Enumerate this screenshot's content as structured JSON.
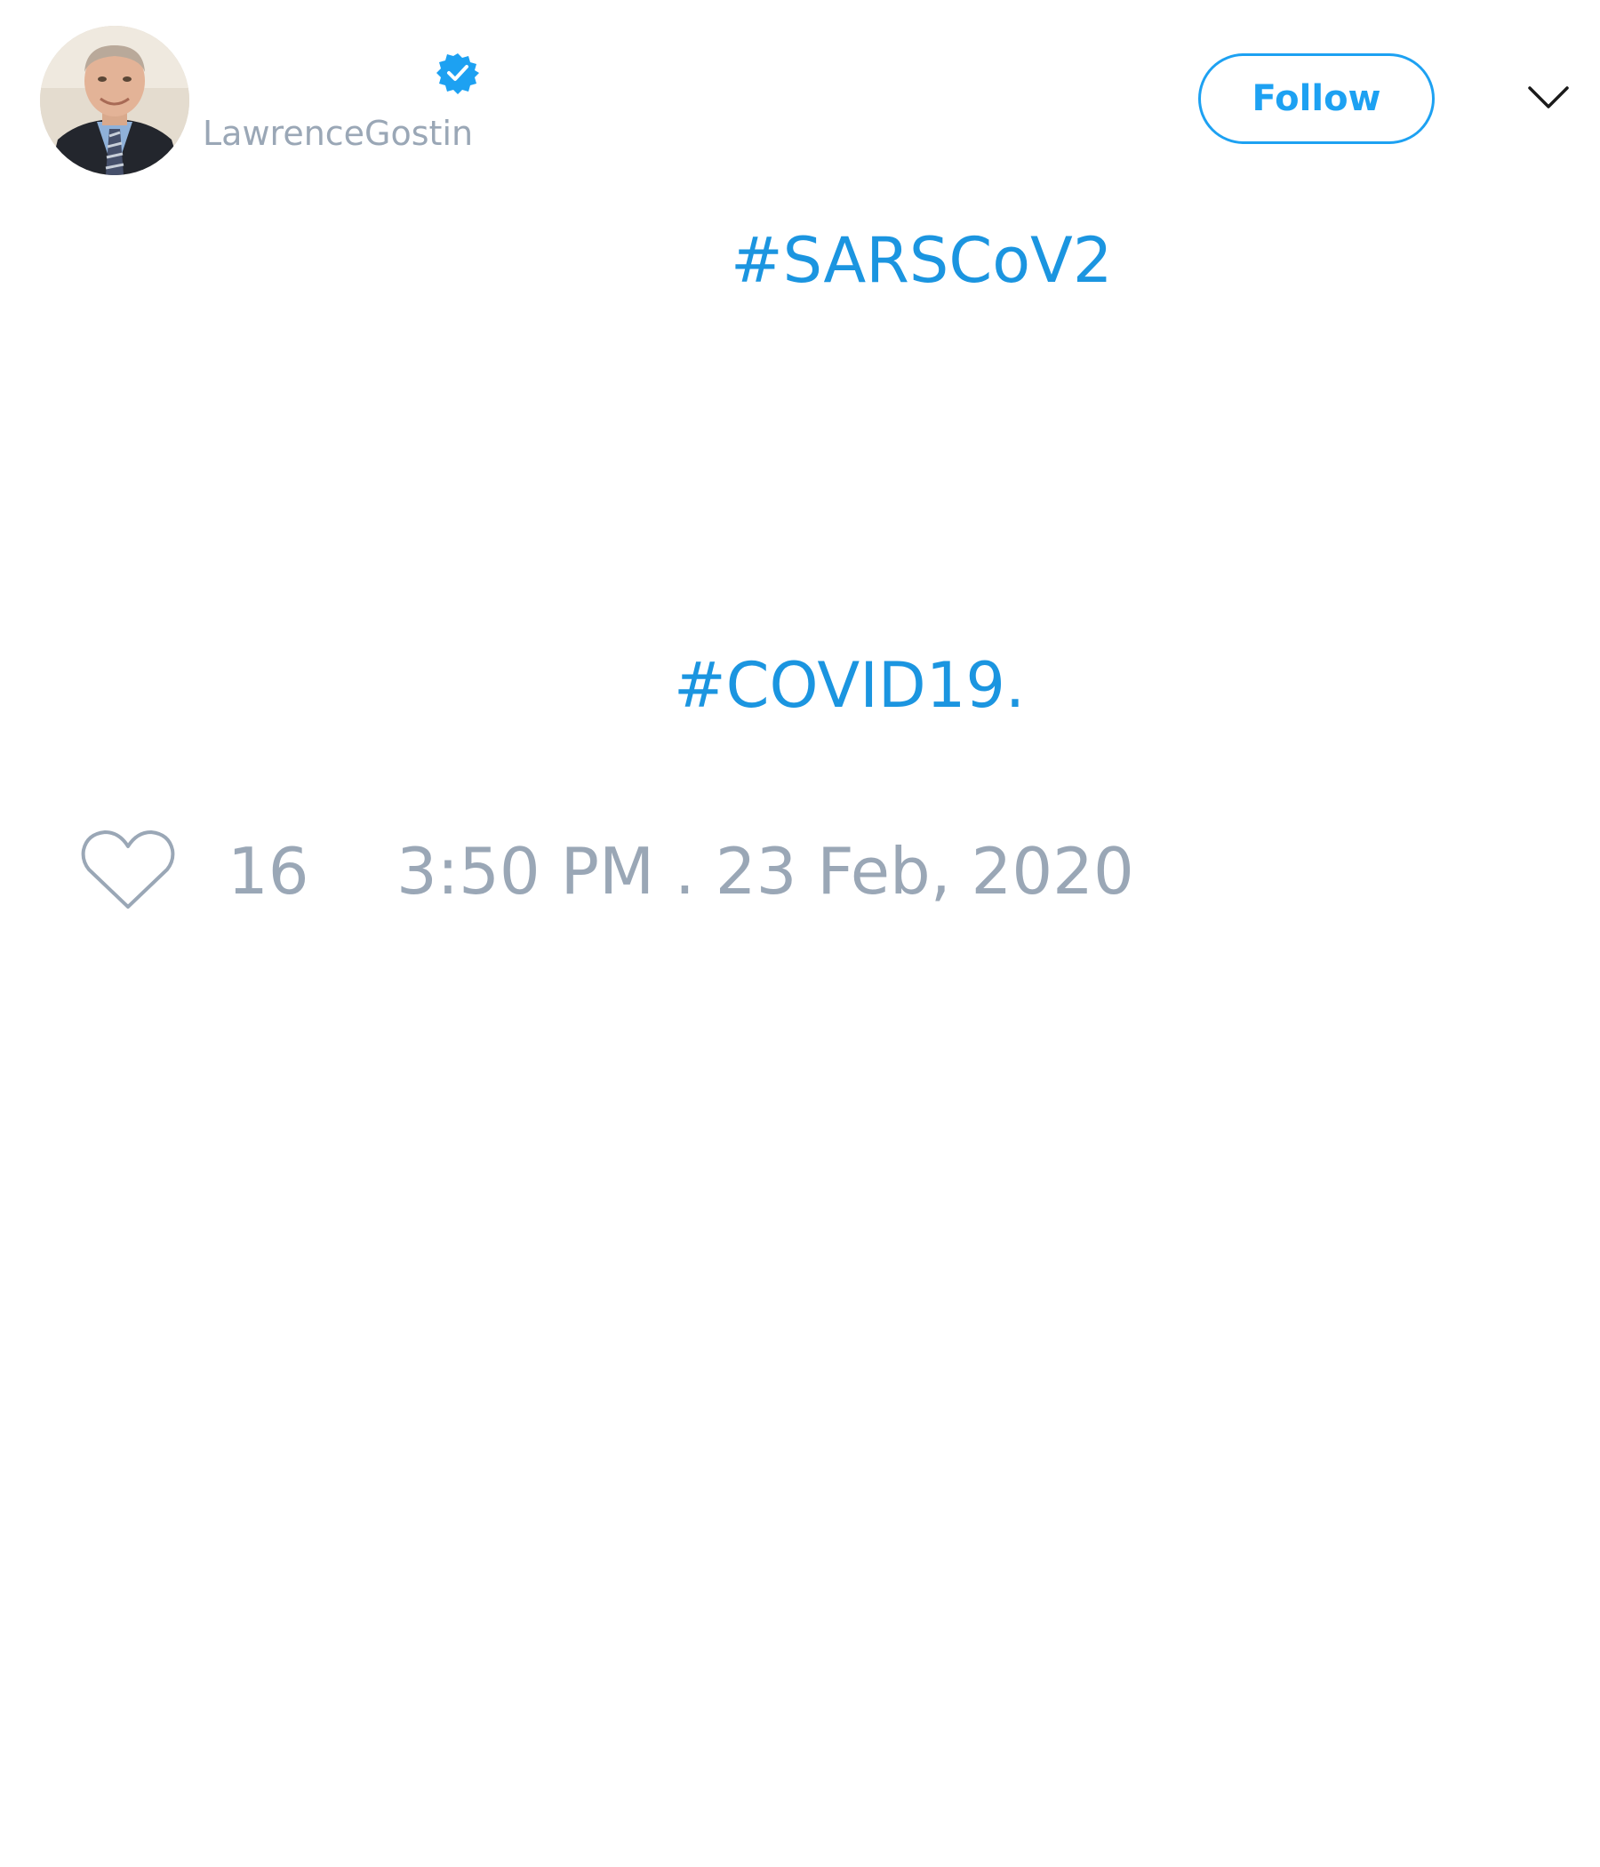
{
  "tweet": {
    "author": {
      "handle": "LawrenceGostin",
      "verified": true,
      "avatar_icon": "profile-photo"
    },
    "follow_label": "Follow",
    "menu_icon": "chevron-down-icon",
    "hashtags": [
      "#SARSCoV2",
      "#COVID19."
    ],
    "like_count": "16",
    "timestamp": "3:50 PM . 23 Feb, 2020"
  },
  "colors": {
    "accent": "#1da1f2",
    "link": "#1b95e0",
    "muted": "#9aa7b6",
    "background": "#ffffff"
  }
}
